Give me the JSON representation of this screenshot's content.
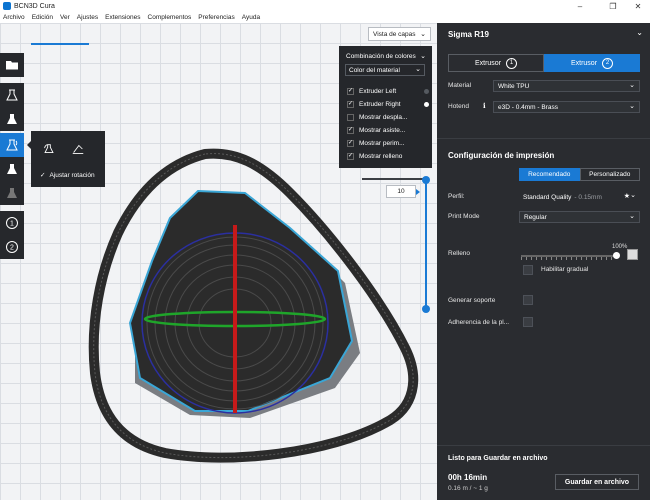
{
  "window": {
    "title": "BCN3D Cura"
  },
  "menu": [
    "Archivo",
    "Edición",
    "Ver",
    "Ajustes",
    "Extensiones",
    "Complementos",
    "Preferencias",
    "Ayuda"
  ],
  "viewport": {
    "view_mode": "Vista de capas",
    "color_scheme": {
      "header": "Combinación de colores",
      "selected": "Color del material",
      "options": [
        {
          "label": "Extruder Left",
          "checked": true,
          "dot": "#555a60"
        },
        {
          "label": "Extruder Right",
          "checked": true,
          "dot": "#ffffff"
        },
        {
          "label": "Mostrar despla...",
          "checked": false
        },
        {
          "label": "Mostrar asiste...",
          "checked": true
        },
        {
          "label": "Mostrar perim...",
          "checked": true
        },
        {
          "label": "Mostrar relleno",
          "checked": true
        }
      ]
    },
    "layer_number": "10",
    "rotate_popup": {
      "snap_label": "Ajustar rotación",
      "snap_checked": true
    },
    "toolbar_icons": [
      "folder-icon",
      "move-tool-icon",
      "scale-tool-icon",
      "rotate-tool-icon",
      "mirror-tool-icon",
      "per-model-settings-icon",
      "extruder-1-icon",
      "extruder-2-icon"
    ],
    "extruder_numbers": [
      "1",
      "2"
    ]
  },
  "printer": {
    "name": "Sigma R19",
    "extruders": [
      {
        "label": "Extrusor",
        "number": "1",
        "active": false
      },
      {
        "label": "Extrusor",
        "number": "2",
        "active": true
      }
    ],
    "material_label": "Material",
    "material_value": "White TPU",
    "hotend_label": "Hotend",
    "hotend_value": "e3D - 0.4mm - Brass"
  },
  "print_settings": {
    "title": "Configuración de impresión",
    "modes": [
      "Recomendado",
      "Personalizado"
    ],
    "active_mode": "Recomendado",
    "profile_label": "Perfil:",
    "profile_value": "Standard Quality",
    "profile_suffix": "- 0.15mm",
    "print_mode_label": "Print Mode",
    "print_mode_value": "Regular",
    "infill_label": "Relleno",
    "infill_percent_label": "100%",
    "infill_percent": 100,
    "gradual_label": "Habilitar gradual",
    "support_label": "Generar soporte",
    "adhesion_label": "Adherencia de la pl..."
  },
  "output": {
    "status": "Listo para Guardar en archivo",
    "time": "00h 16min",
    "material_usage": "0.16 m / ~ 1 g",
    "save_button": "Guardar en archivo"
  },
  "colors": {
    "accent": "#1a7ad4",
    "panel_bg": "#2a2c30",
    "print_layers": "#2b2b2b",
    "outline_cyan": "#3aa6d6",
    "axis_red": "#c61a1a",
    "axis_green": "#1fa52a",
    "axis_blue": "#2b2fa0"
  }
}
